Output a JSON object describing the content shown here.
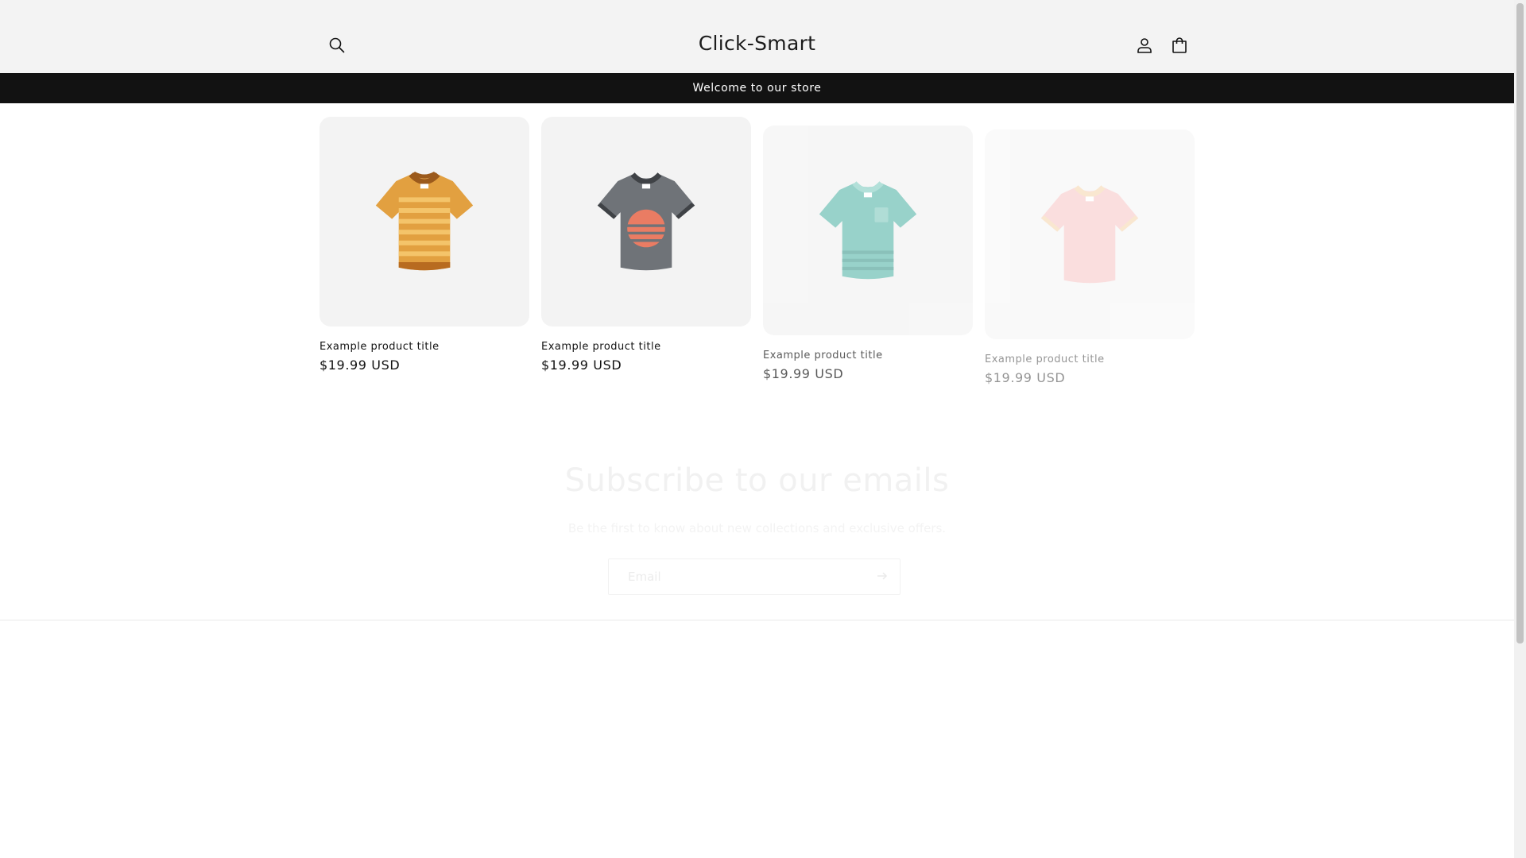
{
  "header": {
    "store_name": "Click-Smart",
    "icons": [
      "search-icon",
      "account-icon",
      "cart-icon"
    ]
  },
  "announcement": {
    "text": "Welcome to our store"
  },
  "products": [
    {
      "title": "Example product title",
      "price": "$19.99 USD",
      "image": "striped-orange-tshirt"
    },
    {
      "title": "Example product title",
      "price": "$19.99 USD",
      "image": "grey-sunset-tshirt"
    },
    {
      "title": "Example product title",
      "price": "$19.99 USD",
      "image": "teal-pocket-tshirt"
    },
    {
      "title": "Example product title",
      "price": "$19.99 USD",
      "image": "pink-tshirt"
    }
  ],
  "newsletter": {
    "heading": "Subscribe to our emails",
    "subtext": "Be the first to know about new collections and exclusive offers.",
    "email_placeholder": "Email"
  },
  "colors": {
    "header_bg": "#f3f3f3",
    "announcement_bg": "#121212",
    "card_bg": "#f3f3f3",
    "text": "#121212"
  }
}
